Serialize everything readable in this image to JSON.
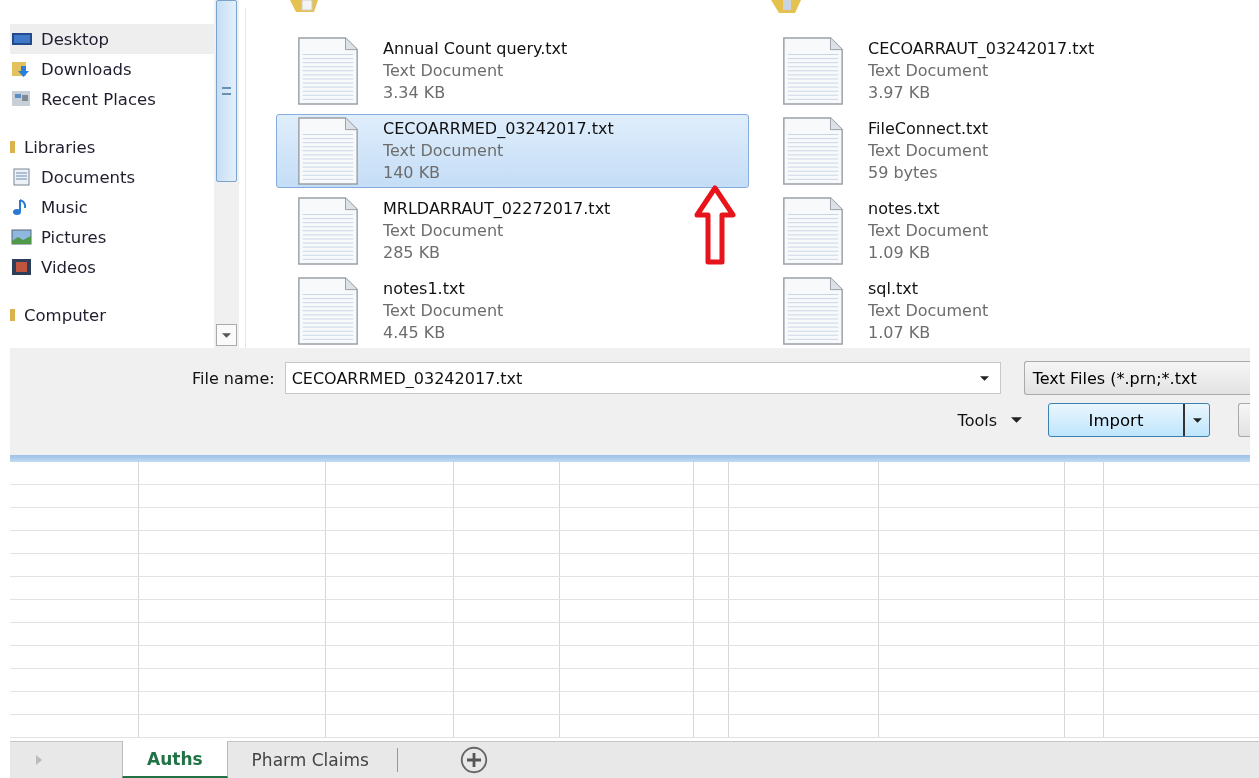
{
  "navigation": {
    "groups": [
      {
        "items": [
          {
            "label": "Desktop",
            "kind": "desktop",
            "selected": true
          },
          {
            "label": "Downloads",
            "kind": "downloads",
            "selected": false
          },
          {
            "label": "Recent Places",
            "kind": "recent",
            "selected": false
          }
        ]
      },
      {
        "label": "Libraries",
        "items": [
          {
            "label": "Documents",
            "kind": "documents",
            "selected": false
          },
          {
            "label": "Music",
            "kind": "music",
            "selected": false
          },
          {
            "label": "Pictures",
            "kind": "pictures",
            "selected": false
          },
          {
            "label": "Videos",
            "kind": "videos",
            "selected": false
          }
        ]
      },
      {
        "label": "Computer"
      }
    ]
  },
  "files": [
    {
      "name": "Annual Count query.txt",
      "type": "Text Document",
      "size": "3.34 KB",
      "selected": false
    },
    {
      "name": "CECOARRAUT_03242017.txt",
      "type": "Text Document",
      "size": "3.97 KB",
      "selected": false
    },
    {
      "name": "CECOARRMED_03242017.txt",
      "type": "Text Document",
      "size": "140 KB",
      "selected": true
    },
    {
      "name": "FileConnect.txt",
      "type": "Text Document",
      "size": "59 bytes",
      "selected": false
    },
    {
      "name": "MRLDARRAUT_02272017.txt",
      "type": "Text Document",
      "size": "285 KB",
      "selected": false
    },
    {
      "name": "notes.txt",
      "type": "Text Document",
      "size": "1.09 KB",
      "selected": false
    },
    {
      "name": "notes1.txt",
      "type": "Text Document",
      "size": "4.45 KB",
      "selected": false
    },
    {
      "name": "sql.txt",
      "type": "Text Document",
      "size": "1.07 KB",
      "selected": false
    }
  ],
  "file_name": {
    "label": "File name:",
    "value": "CECOARRMED_03242017.txt"
  },
  "file_type": {
    "value": "Text Files (*.prn;*.txt"
  },
  "tools": {
    "label": "Tools"
  },
  "import_button": {
    "label": "Import"
  },
  "sheet_tabs": [
    {
      "label": "Auths",
      "selected": true
    },
    {
      "label": "Pharm Claims",
      "selected": false
    }
  ]
}
